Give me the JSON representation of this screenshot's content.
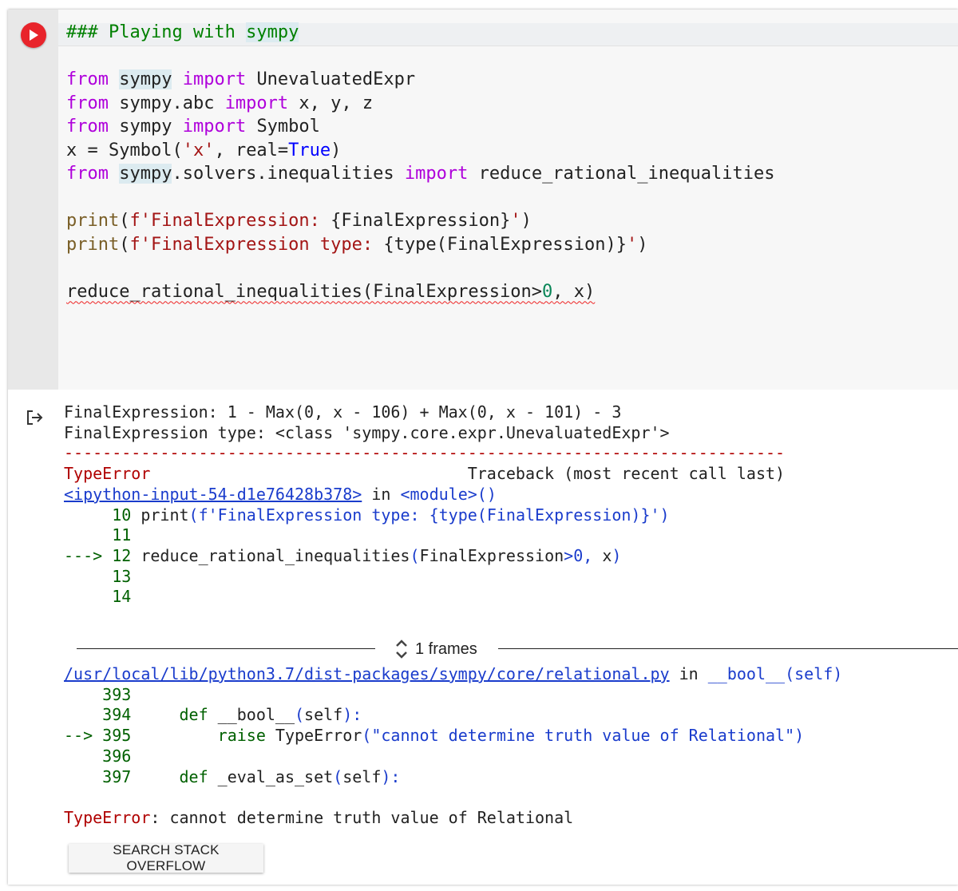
{
  "cell": {
    "run_button_icon": "play-icon",
    "run_button_color": "#e8242b",
    "code_lines": [
      [
        {
          "t": "### Playing with ",
          "c": "cm"
        },
        {
          "t": "sympy",
          "c": "cm hl"
        }
      ],
      [],
      [
        {
          "t": "from ",
          "c": "kw"
        },
        {
          "t": "sympy",
          "c": "hl"
        },
        {
          "t": " import ",
          "c": "kw"
        },
        {
          "t": "UnevaluatedExpr",
          "c": ""
        }
      ],
      [
        {
          "t": "from ",
          "c": "kw"
        },
        {
          "t": "sympy.abc ",
          "c": ""
        },
        {
          "t": "import ",
          "c": "kw"
        },
        {
          "t": "x, y, z",
          "c": ""
        }
      ],
      [
        {
          "t": "from ",
          "c": "kw"
        },
        {
          "t": "sympy ",
          "c": ""
        },
        {
          "t": "import ",
          "c": "kw"
        },
        {
          "t": "Symbol",
          "c": ""
        }
      ],
      [
        {
          "t": "x = Symbol(",
          "c": ""
        },
        {
          "t": "'x'",
          "c": "st"
        },
        {
          "t": ", real=",
          "c": ""
        },
        {
          "t": "True",
          "c": "bl"
        },
        {
          "t": ")",
          "c": ""
        }
      ],
      [
        {
          "t": "from ",
          "c": "kw"
        },
        {
          "t": "sympy",
          "c": "hl"
        },
        {
          "t": ".solvers.inequalities ",
          "c": ""
        },
        {
          "t": "import ",
          "c": "kw"
        },
        {
          "t": "reduce_rational_inequalities",
          "c": ""
        }
      ],
      [],
      [
        {
          "t": "print",
          "c": "bi"
        },
        {
          "t": "(",
          "c": ""
        },
        {
          "t": "f'FinalExpression: ",
          "c": "st"
        },
        {
          "t": "{FinalExpression}",
          "c": ""
        },
        {
          "t": "'",
          "c": "st"
        },
        {
          "t": ")",
          "c": ""
        }
      ],
      [
        {
          "t": "print",
          "c": "bi"
        },
        {
          "t": "(",
          "c": ""
        },
        {
          "t": "f'FinalExpression type: ",
          "c": "st"
        },
        {
          "t": "{type(FinalExpression)}",
          "c": ""
        },
        {
          "t": "'",
          "c": "st"
        },
        {
          "t": ")",
          "c": ""
        }
      ],
      [],
      [
        {
          "t": "reduce_rational_inequalities(FinalExpression>",
          "c": "squiggle"
        },
        {
          "t": "0",
          "c": "nm squiggle"
        },
        {
          "t": ", x)",
          "c": "squiggle"
        }
      ]
    ]
  },
  "output": {
    "output_icon": "output-arrow-icon",
    "lines_top": [
      [
        {
          "t": "FinalExpression: 1 - Max(0, x - 106) + Max(0, x - 101) - 3",
          "c": ""
        }
      ],
      [
        {
          "t": "FinalExpression type: <class 'sympy.core.expr.UnevaluatedExpr'>",
          "c": ""
        }
      ],
      [
        {
          "t": "---------------------------------------------------------------------------",
          "c": "o-red"
        }
      ],
      [
        {
          "t": "TypeError",
          "c": "o-red"
        },
        {
          "t": "                                 Traceback (most recent call last)",
          "c": ""
        }
      ],
      [
        {
          "t": "<ipython-input-54-d1e76428b378>",
          "c": "o-link"
        },
        {
          "t": " in ",
          "c": ""
        },
        {
          "t": "<module>",
          "c": "o-blu"
        },
        {
          "t": "()",
          "c": "o-blu"
        }
      ],
      [
        {
          "t": "     10 ",
          "c": "o-grn"
        },
        {
          "t": "print",
          "c": ""
        },
        {
          "t": "(f'FinalExpression type: {type(FinalExpression)}')",
          "c": "o-blu"
        }
      ],
      [
        {
          "t": "     11",
          "c": "o-grn"
        }
      ],
      [
        {
          "t": "---> 12 ",
          "c": "o-grn"
        },
        {
          "t": "reduce_rational_inequalities",
          "c": ""
        },
        {
          "t": "(",
          "c": "o-blu"
        },
        {
          "t": "FinalExpression",
          "c": ""
        },
        {
          "t": ">0, ",
          "c": "o-blu"
        },
        {
          "t": "x",
          "c": ""
        },
        {
          "t": ")",
          "c": "o-blu"
        }
      ],
      [
        {
          "t": "     13",
          "c": "o-grn"
        }
      ],
      [
        {
          "t": "     14",
          "c": "o-grn"
        }
      ]
    ],
    "frames_icon": "expand-collapse-icon",
    "frames_label": "1 frames",
    "lines_bottom": [
      [
        {
          "t": "/usr/local/lib/python3.7/dist-packages/sympy/core/relational.py",
          "c": "o-link"
        },
        {
          "t": " in ",
          "c": ""
        },
        {
          "t": "__bool__",
          "c": "o-blu"
        },
        {
          "t": "(self)",
          "c": "o-blu"
        }
      ],
      [
        {
          "t": "    393",
          "c": "o-grn"
        }
      ],
      [
        {
          "t": "    394     ",
          "c": "o-grn"
        },
        {
          "t": "def ",
          "c": "o-grn"
        },
        {
          "t": "__bool__",
          "c": ""
        },
        {
          "t": "(",
          "c": "o-blu"
        },
        {
          "t": "self",
          "c": ""
        },
        {
          "t": "):",
          "c": "o-blu"
        }
      ],
      [
        {
          "t": "--> 395         ",
          "c": "o-grn"
        },
        {
          "t": "raise ",
          "c": "o-grn"
        },
        {
          "t": "TypeError",
          "c": ""
        },
        {
          "t": "(\"cannot determine truth value of Relational\")",
          "c": "o-blu"
        }
      ],
      [
        {
          "t": "    396",
          "c": "o-grn"
        }
      ],
      [
        {
          "t": "    397     ",
          "c": "o-grn"
        },
        {
          "t": "def ",
          "c": "o-grn"
        },
        {
          "t": "_eval_as_set",
          "c": ""
        },
        {
          "t": "(",
          "c": "o-blu"
        },
        {
          "t": "self",
          "c": ""
        },
        {
          "t": "):",
          "c": "o-blu"
        }
      ],
      [],
      [
        {
          "t": "TypeError",
          "c": "o-red"
        },
        {
          "t": ": cannot determine truth value of Relational",
          "c": ""
        }
      ]
    ],
    "search_button_label": "SEARCH STACK OVERFLOW"
  }
}
